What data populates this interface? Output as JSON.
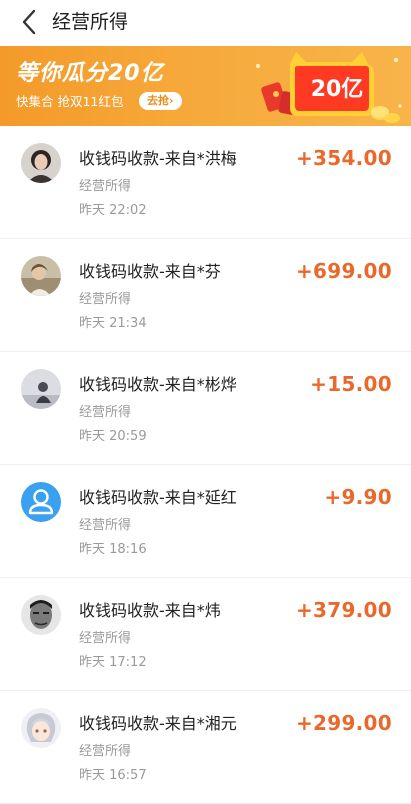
{
  "header": {
    "title": "经营所得",
    "back_icon": "chevron-left-icon"
  },
  "banner": {
    "title": "等你瓜分20亿",
    "subtitle": "快集合 抢双11红包",
    "button_label": "去抢›",
    "badge_text": "20亿"
  },
  "colors": {
    "amount": "#e8692b",
    "banner": "#f6a93a",
    "secondary_text": "#9a9a9a"
  },
  "transactions": [
    {
      "title": "收钱码收款-来自*洪梅",
      "category": "经营所得",
      "time": "昨天  22:02",
      "amount": "+354.00",
      "avatar": "photo-avatar"
    },
    {
      "title": "收钱码收款-来自*芬",
      "category": "经营所得",
      "time": "昨天  21:34",
      "amount": "+699.00",
      "avatar": "photo-avatar"
    },
    {
      "title": "收钱码收款-来自*彬烨",
      "category": "经营所得",
      "time": "昨天  20:59",
      "amount": "+15.00",
      "avatar": "photo-avatar"
    },
    {
      "title": "收钱码收款-来自*延红",
      "category": "经营所得",
      "time": "昨天  18:16",
      "amount": "+9.90",
      "avatar": "default-user-avatar"
    },
    {
      "title": "收钱码收款-来自*炜",
      "category": "经营所得",
      "time": "昨天  17:12",
      "amount": "+379.00",
      "avatar": "photo-avatar"
    },
    {
      "title": "收钱码收款-来自*湘元",
      "category": "经营所得",
      "time": "昨天  16:57",
      "amount": "+299.00",
      "avatar": "anime-avatar"
    }
  ]
}
